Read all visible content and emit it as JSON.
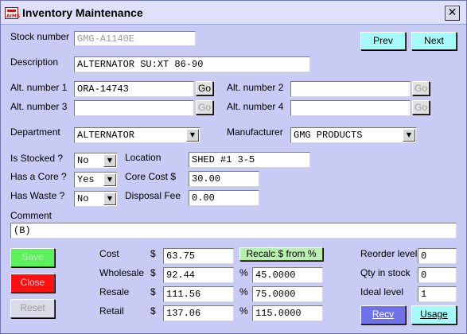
{
  "window": {
    "title": "Inventory Maintenance",
    "icon_text": "AIMS"
  },
  "labels": {
    "stock_number": "Stock number",
    "description": "Description",
    "alt1": "Alt. number 1",
    "alt2": "Alt. number 2",
    "alt3": "Alt. number 3",
    "alt4": "Alt. number 4",
    "department": "Department",
    "manufacturer": "Manufacturer",
    "is_stocked": "Is Stocked ?",
    "has_core": "Has a Core ?",
    "has_waste": "Has Waste ?",
    "location": "Location",
    "core_cost": "Core Cost $",
    "disposal_fee": "Disposal Fee",
    "comment": "Comment",
    "cost": "Cost",
    "wholesale": "Wholesale",
    "resale": "Resale",
    "retail": "Retail",
    "dollar": "$",
    "percent": "%",
    "reorder_level": "Reorder level",
    "qty_in_stock": "Qty in stock",
    "ideal_level": "Ideal level"
  },
  "values": {
    "stock_number": "GMG-A1140E",
    "description": "ALTERNATOR SU:XT 86-90",
    "alt1": "ORA-14743",
    "alt2": "",
    "alt3": "",
    "alt4": "",
    "department": "ALTERNATOR",
    "manufacturer": "GMG PRODUCTS",
    "is_stocked": "No",
    "has_core": "Yes",
    "has_waste": "No",
    "location": "SHED #1 3-5",
    "core_cost": "30.00",
    "disposal_fee": "0.00",
    "comment": "(B)",
    "cost": "63.75",
    "wholesale": "92.44",
    "wholesale_pct": "45.0000",
    "resale": "111.56",
    "resale_pct": "75.0000",
    "retail": "137.06",
    "retail_pct": "115.0000",
    "reorder_level": "0",
    "qty_in_stock": "0",
    "ideal_level": "1"
  },
  "buttons": {
    "prev": "Prev",
    "next": "Next",
    "go": "Go",
    "save": "Save",
    "close": "Close",
    "reset": "Reset",
    "recalc": "Recalc $ from %",
    "recv": "Recv",
    "usage": "Usage"
  }
}
